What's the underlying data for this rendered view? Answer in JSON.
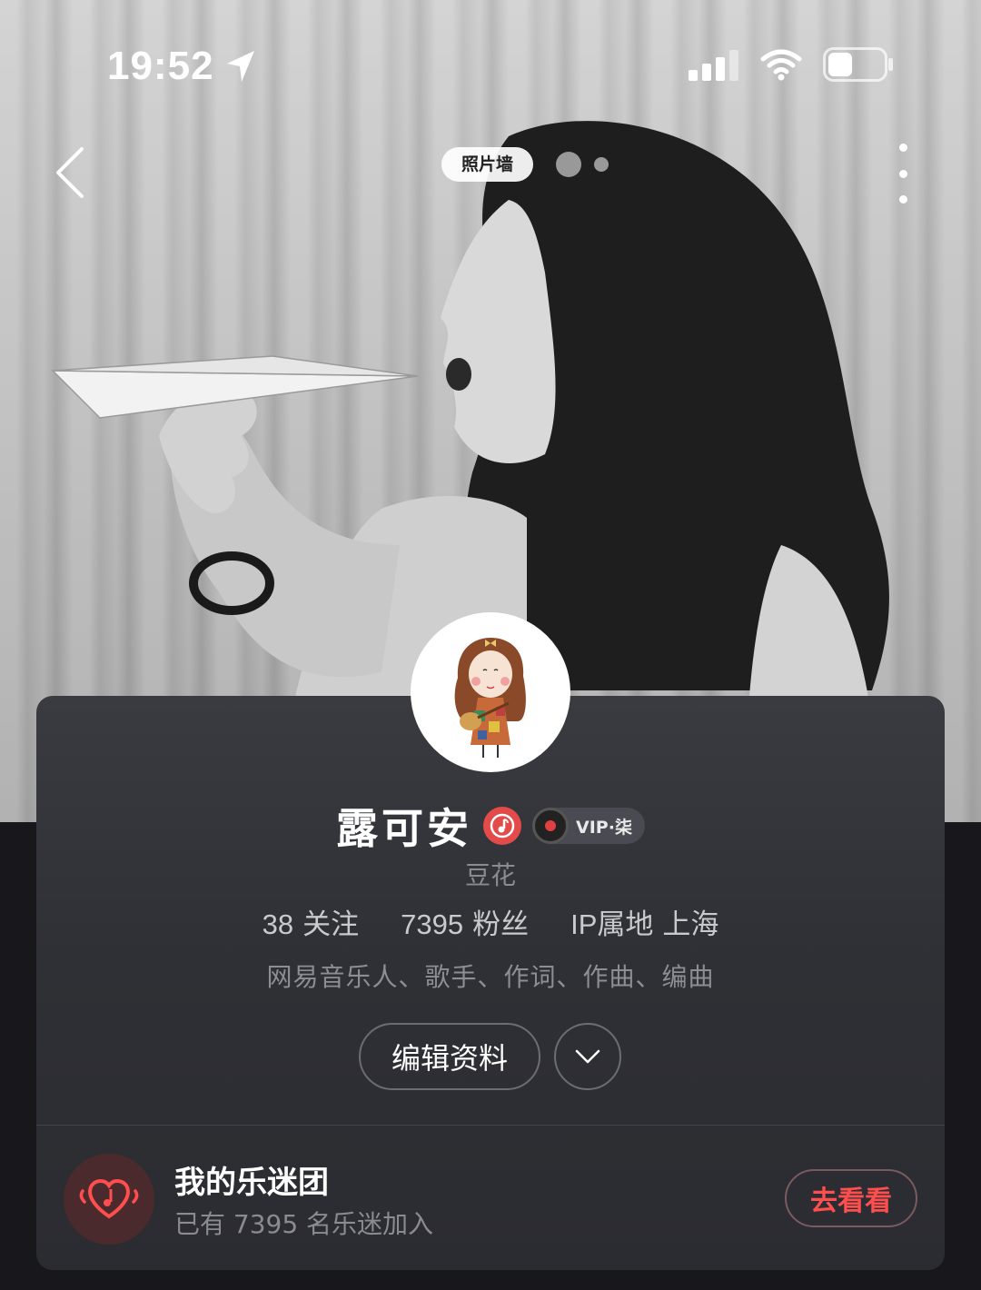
{
  "status_bar": {
    "time": "19:52",
    "icons": [
      "location-arrow-icon",
      "cellular-signal-icon",
      "wifi-icon",
      "battery-icon"
    ]
  },
  "nav": {
    "photo_wall_label": "照片墙",
    "icons": [
      "back-chevron-icon",
      "more-vertical-icon"
    ]
  },
  "profile": {
    "username": "露可安",
    "vip_label": "VIP·柒",
    "nickname_sub": "豆花",
    "stats": [
      {
        "value": "38",
        "label": "关注"
      },
      {
        "value": "7395",
        "label": "粉丝"
      },
      {
        "value": "IP属地",
        "label": "上海"
      }
    ],
    "tags": "网易音乐人、歌手、作词、作曲、编曲",
    "edit_button": "编辑资料"
  },
  "fan_club": {
    "title": "我的乐迷团",
    "subtitle": "已有 7395 名乐迷加入",
    "button": "去看看"
  },
  "colors": {
    "card_bg": "#2f3035",
    "accent_red": "#ff4e4e",
    "badge_red": "#e34b4b"
  }
}
